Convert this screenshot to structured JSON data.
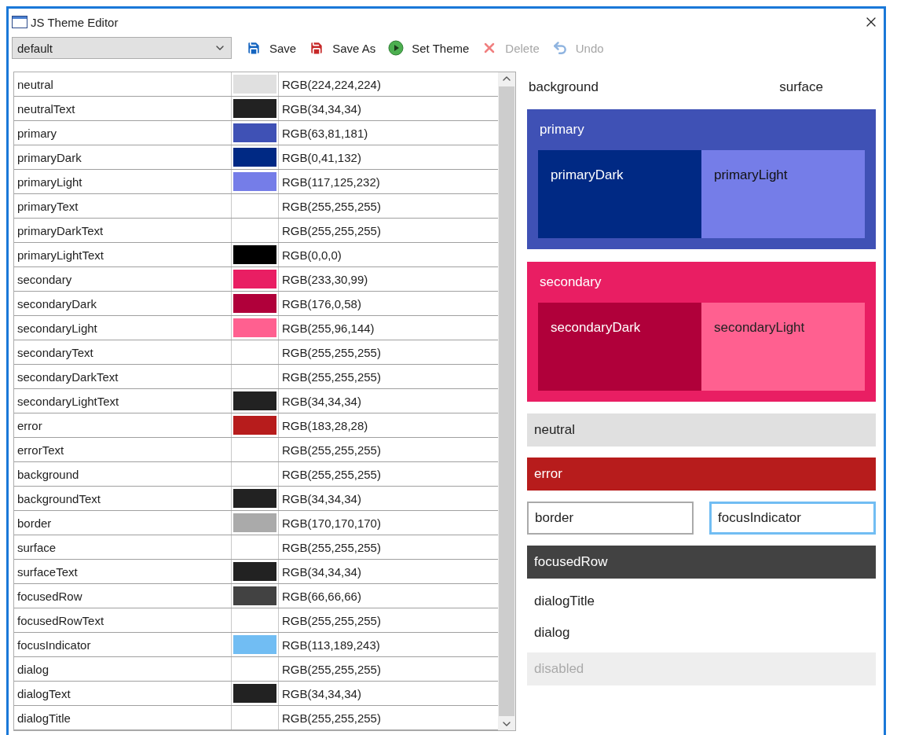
{
  "window": {
    "title": "JS Theme Editor"
  },
  "toolbar": {
    "theme_select": {
      "value": "default"
    },
    "buttons": [
      {
        "label": "Save",
        "kind": "save",
        "disabled": false
      },
      {
        "label": "Save As",
        "kind": "saveas",
        "disabled": false
      },
      {
        "label": "Set Theme",
        "kind": "play",
        "disabled": false
      },
      {
        "label": "Delete",
        "kind": "delete",
        "disabled": true
      },
      {
        "label": "Undo",
        "kind": "undo",
        "disabled": true
      }
    ]
  },
  "colors": [
    {
      "name": "neutral",
      "color": "#e0e0e0",
      "value": "RGB(224,224,224)"
    },
    {
      "name": "neutralText",
      "color": "#222222",
      "value": "RGB(34,34,34)"
    },
    {
      "name": "primary",
      "color": "#3f51b5",
      "value": "RGB(63,81,181)"
    },
    {
      "name": "primaryDark",
      "color": "#002984",
      "value": "RGB(0,41,132)"
    },
    {
      "name": "primaryLight",
      "color": "#757de8",
      "value": "RGB(117,125,232)"
    },
    {
      "name": "primaryText",
      "value": "RGB(255,255,255)"
    },
    {
      "name": "primaryDarkText",
      "value": "RGB(255,255,255)"
    },
    {
      "name": "primaryLightText",
      "color": "#000000",
      "value": "RGB(0,0,0)"
    },
    {
      "name": "secondary",
      "color": "#e91e63",
      "value": "RGB(233,30,99)"
    },
    {
      "name": "secondaryDark",
      "color": "#b0003a",
      "value": "RGB(176,0,58)"
    },
    {
      "name": "secondaryLight",
      "color": "#ff6090",
      "value": "RGB(255,96,144)"
    },
    {
      "name": "secondaryText",
      "value": "RGB(255,255,255)"
    },
    {
      "name": "secondaryDarkText",
      "value": "RGB(255,255,255)"
    },
    {
      "name": "secondaryLightText",
      "color": "#222222",
      "value": "RGB(34,34,34)"
    },
    {
      "name": "error",
      "color": "#b71c1c",
      "value": "RGB(183,28,28)"
    },
    {
      "name": "errorText",
      "value": "RGB(255,255,255)"
    },
    {
      "name": "background",
      "value": "RGB(255,255,255)"
    },
    {
      "name": "backgroundText",
      "color": "#222222",
      "value": "RGB(34,34,34)"
    },
    {
      "name": "border",
      "color": "#aaaaaa",
      "value": "RGB(170,170,170)"
    },
    {
      "name": "surface",
      "value": "RGB(255,255,255)"
    },
    {
      "name": "surfaceText",
      "color": "#222222",
      "value": "RGB(34,34,34)"
    },
    {
      "name": "focusedRow",
      "color": "#424242",
      "value": "RGB(66,66,66)"
    },
    {
      "name": "focusedRowText",
      "value": "RGB(255,255,255)"
    },
    {
      "name": "focusIndicator",
      "color": "#71bdf3",
      "value": "RGB(113,189,243)"
    },
    {
      "name": "dialog",
      "value": "RGB(255,255,255)"
    },
    {
      "name": "dialogText",
      "color": "#222222",
      "value": "RGB(34,34,34)"
    },
    {
      "name": "dialogTitle",
      "value": "RGB(255,255,255)"
    }
  ],
  "preview": {
    "background": "background",
    "surface": "surface",
    "groups": [
      {
        "label": "primary",
        "dark": "primaryDark",
        "light": "primaryLight",
        "kind": "primary"
      },
      {
        "label": "secondary",
        "dark": "secondaryDark",
        "light": "secondaryLight",
        "kind": "secondary"
      }
    ],
    "neutral": "neutral",
    "error": "error",
    "border": "border",
    "focus_indicator": "focusIndicator",
    "focused_row": "focusedRow",
    "dialog_title": "dialogTitle",
    "dialog": "dialog",
    "disabled": "disabled"
  }
}
